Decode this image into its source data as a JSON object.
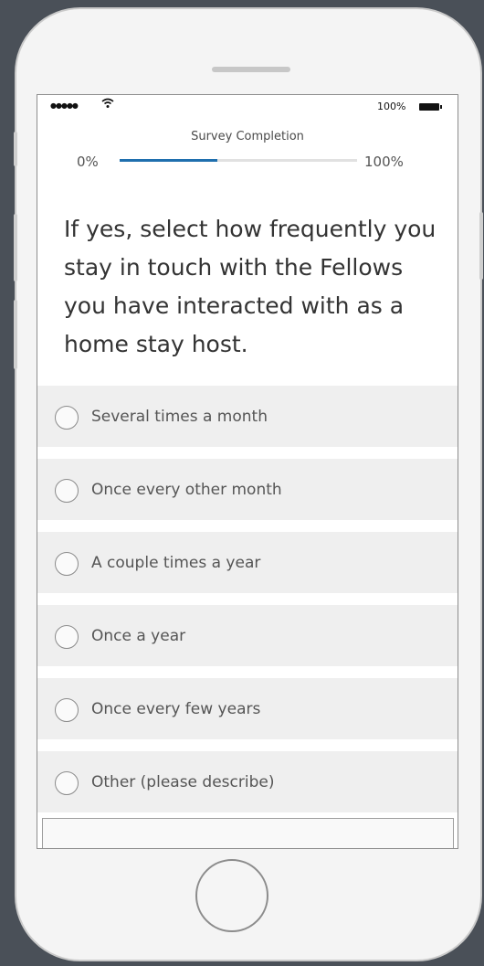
{
  "status_bar": {
    "signal": "●●●●●",
    "wifi_icon": "wifi-icon",
    "battery": "100%"
  },
  "progress": {
    "title": "Survey Completion",
    "start_label": "0%",
    "end_label": "100%",
    "value": 0.41,
    "accent_color": "#1f6fae"
  },
  "question": {
    "text": "If yes, select how frequently you stay in touch with the Fellows you have interacted with as a home stay host."
  },
  "options": [
    {
      "label": "Several times a month"
    },
    {
      "label": "Once every other month"
    },
    {
      "label": "A couple times a year"
    },
    {
      "label": "Once a year"
    },
    {
      "label": "Once every few years"
    },
    {
      "label": "Other (please describe)"
    }
  ]
}
